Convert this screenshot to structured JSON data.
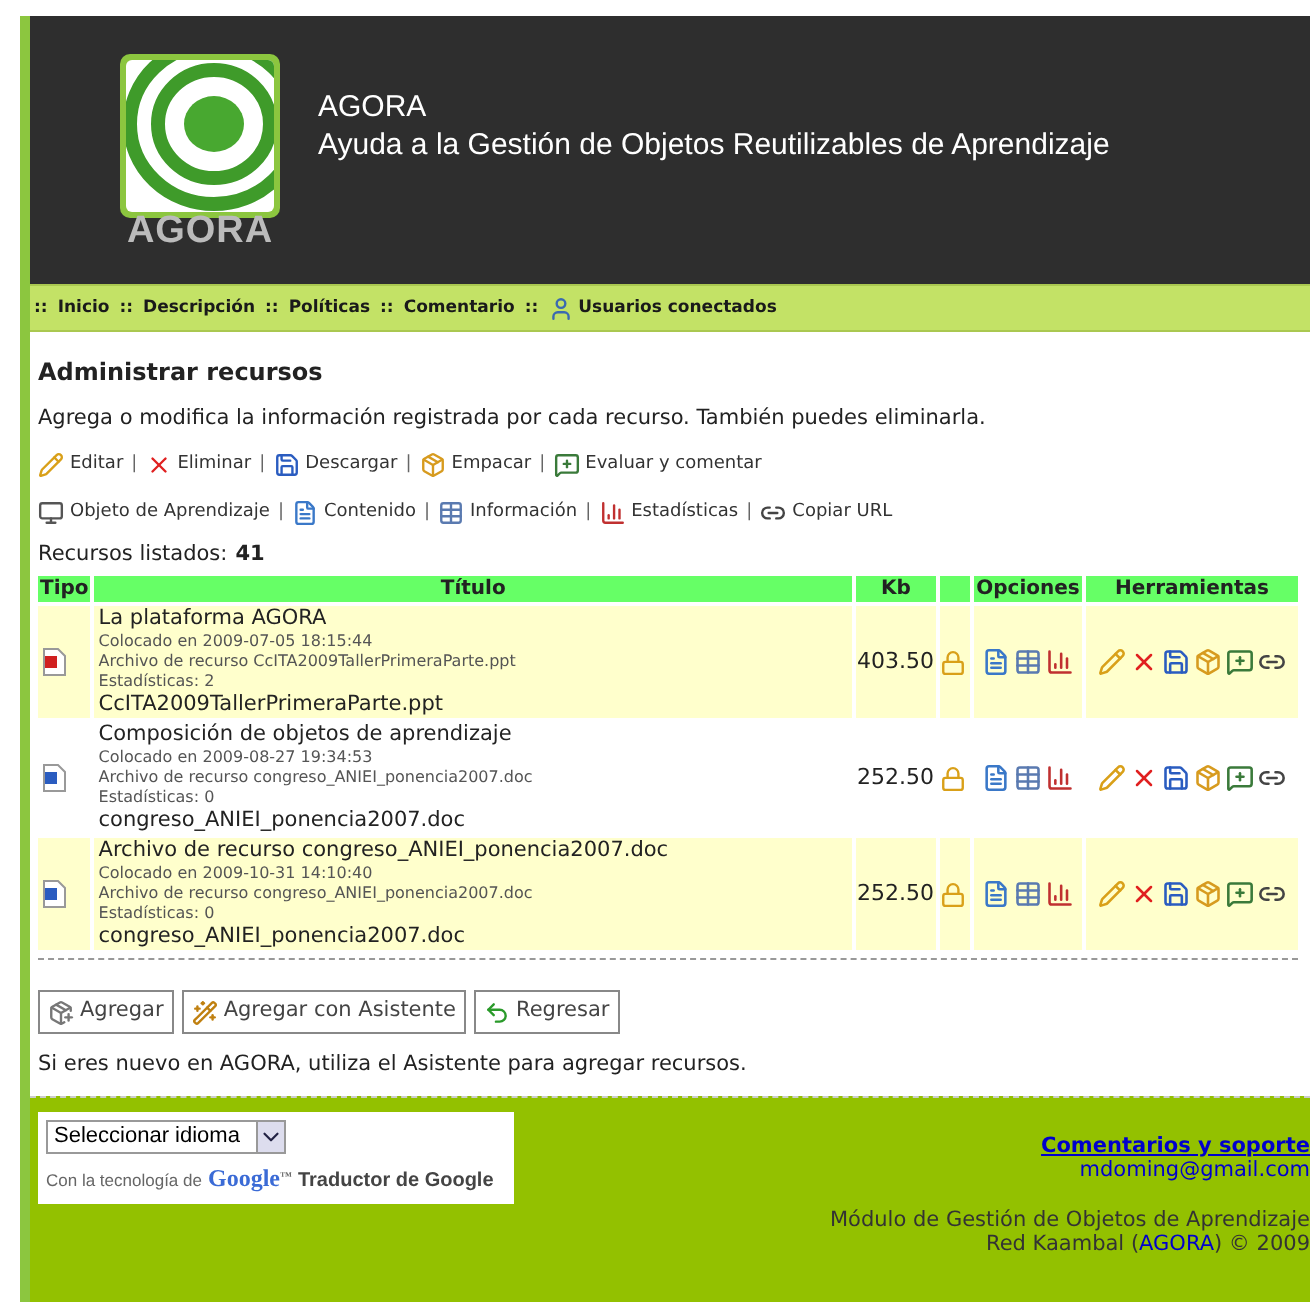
{
  "header": {
    "logo_text": "AGORA",
    "title": "AGORA",
    "subtitle": "Ayuda a la Gestión de Objetos Reutilizables de Aprendizaje"
  },
  "nav": [
    {
      "prefix": "::",
      "label": "Inicio"
    },
    {
      "prefix": "::",
      "label": "Descripción"
    },
    {
      "prefix": "::",
      "label": "Políticas"
    },
    {
      "prefix": "::",
      "label": "Comentario"
    },
    {
      "prefix": "::",
      "label": "Usuarios conectados",
      "kind": "users"
    }
  ],
  "heading": "Administrar recursos",
  "description": "Agrega o modifica la información registrada por cada recurso. También puedes eliminarla.",
  "legend": [
    [
      {
        "kind": "edit",
        "label": "Editar"
      },
      {
        "prefix": "|",
        "kind": "delete",
        "label": "Eliminar"
      },
      {
        "prefix": "|",
        "kind": "save",
        "label": "Descargar"
      },
      {
        "prefix": "|",
        "kind": "package",
        "label": "Empacar"
      },
      {
        "prefix": "|",
        "kind": "comment",
        "label": "Evaluar y comentar"
      }
    ],
    [
      {
        "kind": "monitor",
        "label": "Objeto de Aprendizaje"
      },
      {
        "prefix": "|",
        "kind": "page",
        "label": "Contenido"
      },
      {
        "prefix": "|",
        "kind": "table",
        "label": "Información"
      },
      {
        "prefix": "|",
        "kind": "chart",
        "label": "Estadísticas"
      },
      {
        "prefix": "|",
        "kind": "link",
        "label": "Copiar URL"
      }
    ]
  ],
  "count_label": "Recursos listados:",
  "count": "41",
  "table": {
    "columns": [
      "Tipo",
      "Título",
      "Kb",
      "Opciones",
      "Herramientas"
    ],
    "rows": [
      {
        "kind": "ppt",
        "title": "La plataforma AGORA",
        "placed": "Colocado en 2009-07-05 18:15:44",
        "file": "Archivo de recurso CcITA2009TallerPrimeraParte.ppt",
        "stats": "Estadísticas: 2",
        "filename": "CcITA2009TallerPrimeraParte.ppt",
        "kb": "403.50"
      },
      {
        "kind": "doc",
        "title": "Composición de objetos de aprendizaje",
        "placed": "Colocado en 2009-08-27 19:34:53",
        "file": "Archivo de recurso congreso_ANIEI_ponencia2007.doc",
        "stats": "Estadísticas: 0",
        "filename": "congreso_ANIEI_ponencia2007.doc",
        "kb": "252.50"
      },
      {
        "kind": "doc",
        "title": "Archivo de recurso congreso_ANIEI_ponencia2007.doc",
        "placed": "Colocado en 2009-10-31 14:10:40",
        "file": "Archivo de recurso congreso_ANIEI_ponencia2007.doc",
        "stats": "Estadísticas: 0",
        "filename": "congreso_ANIEI_ponencia2007.doc",
        "kb": "252.50"
      }
    ]
  },
  "buttons": [
    {
      "kind": "add",
      "label": "Agregar"
    },
    {
      "kind": "wizard",
      "label": "Agregar con Asistente"
    },
    {
      "kind": "back",
      "label": "Regresar"
    }
  ],
  "note": "Si eres nuevo en AGORA, utiliza el Asistente para agregar recursos.",
  "footer": {
    "language_select": "Seleccionar idioma",
    "powered_by": "Con la tecnología de",
    "google": "Google",
    "tm": "™",
    "translator": "Traductor de Google",
    "support_link": "Comentarios y soporte",
    "email": "mdoming@gmail.com",
    "module": "Módulo de Gestión de Objetos de Aprendizaje",
    "credit_prefix": "Red Kaambal (",
    "credit_link": "AGORA",
    "credit_suffix": ") © 2009"
  }
}
